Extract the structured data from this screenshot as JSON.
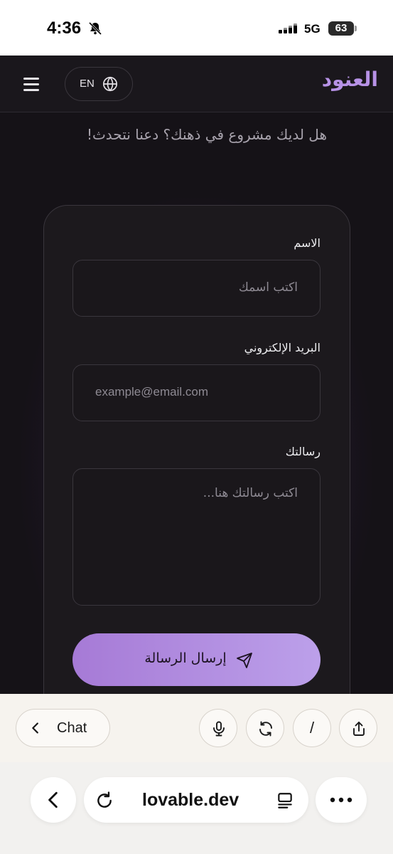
{
  "status_bar": {
    "time": "4:36",
    "network": "5G",
    "battery": "63"
  },
  "navbar": {
    "logo": "العنود",
    "language_label": "EN"
  },
  "page": {
    "tagline": "هل لديك مشروع في ذهنك؟ دعنا نتحدث!"
  },
  "form": {
    "name_label": "الاسم",
    "name_placeholder": "اكتب اسمك",
    "email_label": "البريد الإلكتروني",
    "email_placeholder": "example@email.com",
    "message_label": "رسالتك",
    "message_placeholder": "اكتب رسالتك هنا...",
    "submit_label": "إرسال الرسالة"
  },
  "chat_toolbar": {
    "chat_label": "Chat",
    "slash_label": "/"
  },
  "browser": {
    "url": "lovable.dev"
  },
  "colors": {
    "accent": "#b792e6",
    "app_background": "#151217",
    "button_gradient_start": "#a67ad6",
    "button_gradient_end": "#bca0ea"
  }
}
